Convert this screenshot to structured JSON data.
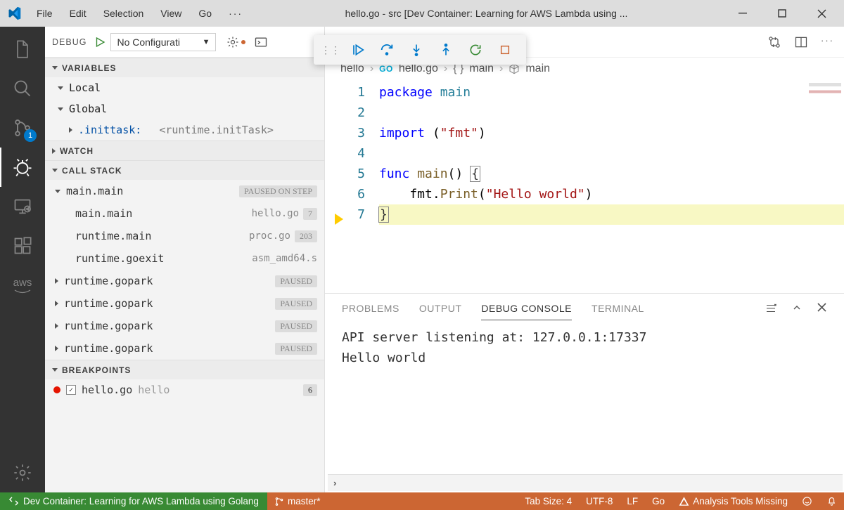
{
  "title": "hello.go - src [Dev Container: Learning for AWS Lambda using ...",
  "menu": [
    "File",
    "Edit",
    "Selection",
    "View",
    "Go"
  ],
  "debug": {
    "label": "DEBUG",
    "config": "No Configurati",
    "sections": {
      "variables": "VARIABLES",
      "local": "Local",
      "global": "Global",
      "inittask_key": ".inittask:",
      "inittask_val": "<runtime.initTask>",
      "watch": "WATCH",
      "callstack": "CALL STACK",
      "breakpoints": "BREAKPOINTS"
    },
    "callstack": [
      {
        "name": "main.main",
        "status": "PAUSED ON STEP",
        "chev": "down"
      },
      {
        "name": "main.main",
        "file": "hello.go",
        "line": "7"
      },
      {
        "name": "runtime.main",
        "file": "proc.go",
        "line": "203"
      },
      {
        "name": "runtime.goexit",
        "file": "asm_amd64.s"
      },
      {
        "name": "runtime.gopark",
        "status": "PAUSED",
        "chev": "right"
      },
      {
        "name": "runtime.gopark",
        "status": "PAUSED",
        "chev": "right"
      },
      {
        "name": "runtime.gopark",
        "status": "PAUSED",
        "chev": "right"
      },
      {
        "name": "runtime.gopark",
        "status": "PAUSED",
        "chev": "right"
      }
    ],
    "breakpoint": {
      "file": "hello.go",
      "func": "hello",
      "line": "6"
    }
  },
  "scm_badge": "1",
  "breadcrumbs": {
    "folder": "hello",
    "go": "GO",
    "file": "hello.go",
    "braces": "{ }",
    "pkg": "main",
    "sym": "main"
  },
  "code": {
    "lines": [
      {
        "n": "1",
        "tokens": [
          [
            "kw",
            "package "
          ],
          [
            "id",
            "main"
          ]
        ]
      },
      {
        "n": "2",
        "tokens": []
      },
      {
        "n": "3",
        "tokens": [
          [
            "kw",
            "import "
          ],
          [
            "plain",
            "("
          ],
          [
            "str",
            "\"fmt\""
          ],
          [
            "plain",
            ")"
          ]
        ]
      },
      {
        "n": "4",
        "tokens": []
      },
      {
        "n": "5",
        "tokens": [
          [
            "kw",
            "func "
          ],
          [
            "fn",
            "main"
          ],
          [
            "plain",
            "() "
          ],
          [
            "curbox",
            "{"
          ]
        ]
      },
      {
        "n": "6",
        "bp": true,
        "tokens": [
          [
            "plain",
            "    fmt."
          ],
          [
            "fn",
            "Print"
          ],
          [
            "plain",
            "("
          ],
          [
            "str",
            "\"Hello world\""
          ],
          [
            "plain",
            ")"
          ]
        ]
      },
      {
        "n": "7",
        "arrow": true,
        "hl": true,
        "tokens": [
          [
            "curbox",
            "}"
          ]
        ]
      }
    ]
  },
  "panel": {
    "tabs": [
      "PROBLEMS",
      "OUTPUT",
      "DEBUG CONSOLE",
      "TERMINAL"
    ],
    "active": "DEBUG CONSOLE",
    "lines": [
      "API server listening at: 127.0.0.1:17337",
      "Hello world"
    ]
  },
  "status": {
    "remote": "Dev Container: Learning for AWS Lambda using Golang",
    "branch": "master*",
    "tabsize": "Tab Size: 4",
    "enc": "UTF-8",
    "eol": "LF",
    "lang": "Go",
    "warn": "Analysis Tools Missing"
  }
}
